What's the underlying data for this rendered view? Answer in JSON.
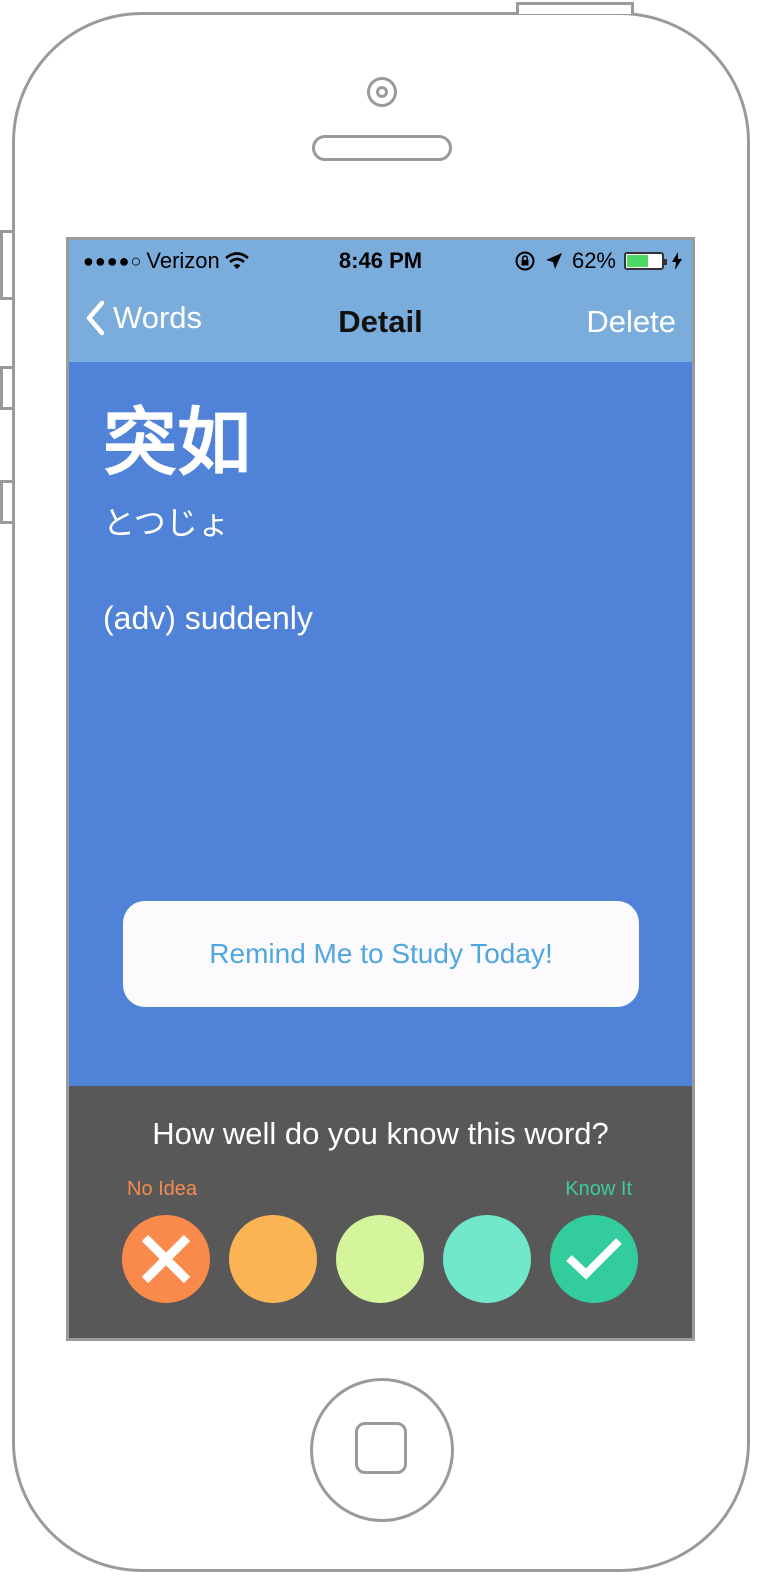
{
  "status": {
    "carrier": "Verizon",
    "time": "8:46 PM",
    "battery": "62%",
    "battery_level": 0.62,
    "signal_dots": "●●●●○"
  },
  "nav": {
    "back_label": "Words",
    "title": "Detail",
    "delete_label": "Delete"
  },
  "word": {
    "kanji": "突如",
    "reading": "とつじょ",
    "meaning": "(adv) suddenly"
  },
  "remind_button": "Remind Me to Study Today!",
  "rating": {
    "question": "How well do you know this word?",
    "low_label": "No Idea",
    "high_label": "Know It",
    "options": [
      {
        "color": "#fa8a4c",
        "icon": "x-icon"
      },
      {
        "color": "#fbb453",
        "icon": ""
      },
      {
        "color": "#d5f59c",
        "icon": ""
      },
      {
        "color": "#72e8cb",
        "icon": ""
      },
      {
        "color": "#33cc9c",
        "icon": "check-icon"
      }
    ]
  },
  "colors": {
    "nav_bg": "#7aacdc",
    "content_bg": "#5083d8",
    "rating_bg": "#585858",
    "remind_text": "#4ea7e0"
  }
}
